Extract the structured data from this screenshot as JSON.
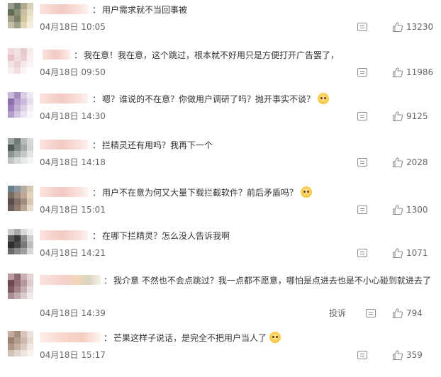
{
  "comments": [
    {
      "text": "用户需求就不当回事被",
      "time": "04月18日 10:05",
      "likes": "13230",
      "avatar": [
        "#9a9a8e",
        "#6f7a66",
        "#b0a98c",
        "#d7d0b8",
        "#5f6b55",
        "#8a8f75",
        "#c8c0a0",
        "#e4dcc4",
        "#a59f88",
        "#7b8068",
        "#d2c49c",
        "#f0e8d0",
        "#c4bfa8",
        "#9da08a",
        "#e0d5b5",
        "#f4efe0"
      ]
    },
    {
      "text": "我在意！我在意，这个跳过，根本就不好用只是方便打开广告罢了，",
      "time": "04月18日 09:50",
      "likes": "11986",
      "avatar": [
        "#efd8da",
        "#f3e2e4",
        "#e8c9cc",
        "#f7ebec",
        "#e6c4c8",
        "#f1dcdf",
        "#ead0d3",
        "#faf1f2",
        "#f4e3e5",
        "#ecd2d5",
        "#f6e9ea",
        "#fbf3f4",
        "#f8eeef",
        "#f2dfe1",
        "#fcf6f6",
        "#ffffff"
      ]
    },
    {
      "text": "嗯？谁说的不在意？你做用户调研了吗？抛开事实不谈？",
      "time": "04月18日 14:30",
      "likes": "9125",
      "emoji": true,
      "avatar": [
        "#c8b9d6",
        "#a58ec0",
        "#d9cfe4",
        "#eee8f4",
        "#8d6fae",
        "#b6a2cc",
        "#cbbcdb",
        "#e7def0",
        "#9b7fb8",
        "#c2b0d4",
        "#dcd1e7",
        "#f2edf7",
        "#b49fcb",
        "#d3c6e1",
        "#ebe3f2",
        "#f8f5fb"
      ]
    },
    {
      "text": "拦精灵还有用吗？我再下一个",
      "time": "04月18日 14:18",
      "likes": "2028",
      "avatar": [
        "#9aa3a0",
        "#6f7b78",
        "#b5bbb8",
        "#d5d9d7",
        "#4e5a57",
        "#7c8785",
        "#a3aba8",
        "#cfd4d2",
        "#8a9491",
        "#a9b0ae",
        "#c3c9c7",
        "#e3e6e5",
        "#c0c5c3",
        "#d6dad8",
        "#e6e9e8",
        "#f3f5f4"
      ]
    },
    {
      "text": "用户不在意为何又大量下载拦截软件？前后矛盾吗？",
      "time": "04月18日 15:01",
      "likes": "1300",
      "emoji": true,
      "avatar": [
        "#6a7f8c",
        "#8a98a0",
        "#b4aca0",
        "#d6c9b6",
        "#7a6a64",
        "#9e8a7c",
        "#c1a892",
        "#e2d2c0",
        "#5a4e4c",
        "#847066",
        "#a68e7e",
        "#d9c7b5",
        "#6d5f5c",
        "#937d70",
        "#bba593",
        "#e9dccd"
      ]
    },
    {
      "text": "在哪下拦精灵？怎么没人告诉我啊",
      "time": "04月18日 14:21",
      "likes": "1071",
      "avatar": [
        "#c9c9c9",
        "#a8a8a8",
        "#d9d9d9",
        "#eeeeee",
        "#5c5c5c",
        "#3a3a3a",
        "#8e8e8e",
        "#cfcfcf",
        "#2e2e2e",
        "#4a4a4a",
        "#7a7a7a",
        "#bdbdbd",
        "#6a6a6a",
        "#8a8a8a",
        "#a0a0a0",
        "#d6d6d6"
      ]
    },
    {
      "text": "我介意 不然也不会点跳过？我一点都不愿意，哪怕是点进去也是不小心碰到就进去了",
      "time": "04月18日 14:39",
      "likes": "794",
      "report": "投诉",
      "avatar": [
        "#b89aa0",
        "#8f6b73",
        "#c9b0b4",
        "#e4d4d6",
        "#6e4752",
        "#94707a",
        "#b7979e",
        "#ddc9cc",
        "#7d5a62",
        "#a3848b",
        "#c6aeb3",
        "#e8dcde",
        "#a88f94",
        "#c2acb0",
        "#dbcdd0",
        "#f1eaeb"
      ]
    },
    {
      "text": "芒果这样子说话，是完全不把用户当人了",
      "time": "04月18日 15:17",
      "likes": "359",
      "emoji": true,
      "avatar": [
        "#c4ada0",
        "#a8907f",
        "#d8c6ba",
        "#ece2da",
        "#9a8070",
        "#b59d8d",
        "#cdb8aa",
        "#e6d9cf",
        "#af9685",
        "#c6b0a1",
        "#dccbbf",
        "#f1e8e2",
        "#d2c0b4",
        "#e2d5cb",
        "#eee5de",
        "#f8f3ef"
      ]
    }
  ]
}
